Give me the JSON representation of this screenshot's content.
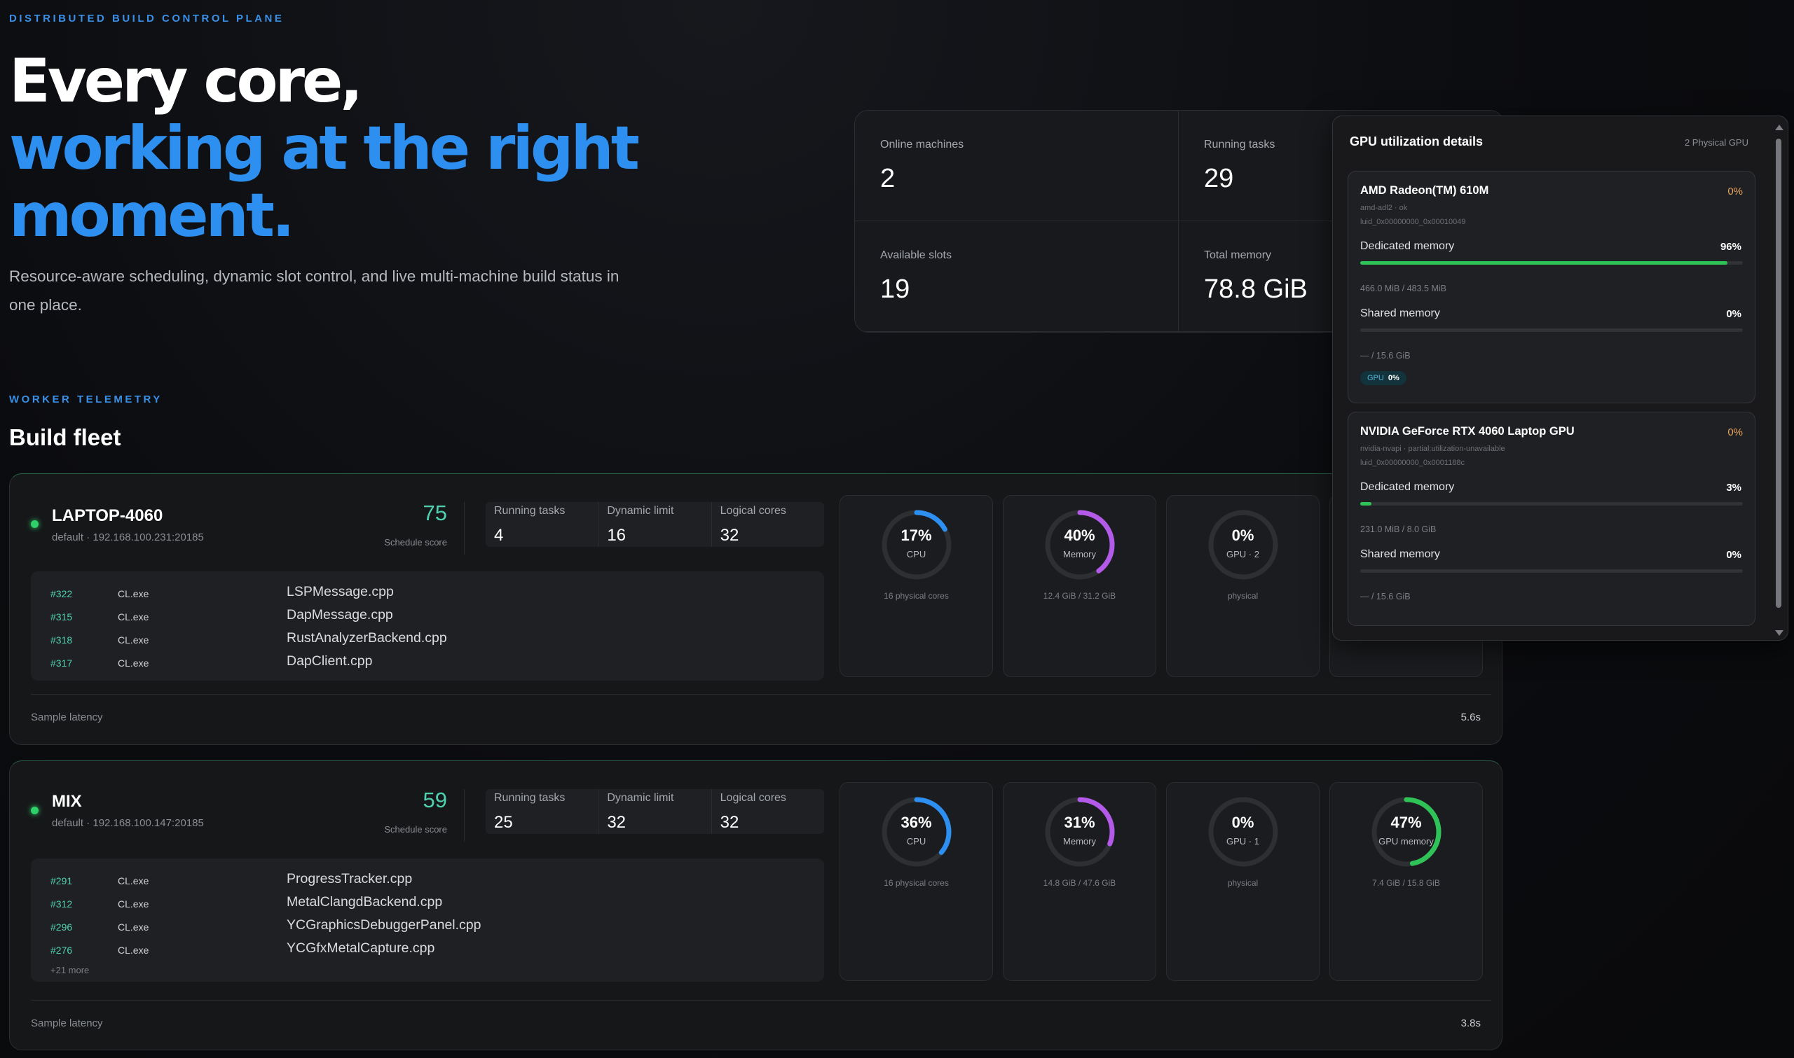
{
  "header": {
    "eyebrow": "DISTRIBUTED BUILD CONTROL PLANE",
    "hero_line1": "Every core,",
    "hero_line2": "working at the right",
    "hero_line3": "moment.",
    "subtitle": "Resource-aware scheduling, dynamic slot control, and live multi-machine build status in one place."
  },
  "summary": [
    {
      "label": "Online machines",
      "value": "2"
    },
    {
      "label": "Running tasks",
      "value": "29"
    },
    {
      "label": "Available slots",
      "value": "19"
    },
    {
      "label": "Total memory",
      "value": "78.8 GiB"
    }
  ],
  "fleet_section": {
    "eyebrow": "WORKER TELEMETRY",
    "title": "Build fleet"
  },
  "machines": [
    {
      "name": "LAPTOP-4060",
      "address": "default · 192.168.100.231:20185",
      "score": "75",
      "score_label": "Schedule score",
      "stats": [
        {
          "label": "Running tasks",
          "value": "4"
        },
        {
          "label": "Dynamic limit",
          "value": "16"
        },
        {
          "label": "Logical cores",
          "value": "32"
        }
      ],
      "tasks": [
        {
          "id": "#322",
          "proc": "CL.exe",
          "file": "LSPMessage.cpp"
        },
        {
          "id": "#315",
          "proc": "CL.exe",
          "file": "DapMessage.cpp"
        },
        {
          "id": "#318",
          "proc": "CL.exe",
          "file": "RustAnalyzerBackend.cpp"
        },
        {
          "id": "#317",
          "proc": "CL.exe",
          "file": "DapClient.cpp"
        }
      ],
      "gauges": [
        {
          "value": "17%",
          "label": "CPU",
          "sub": "16 physical cores",
          "fraction": 0.17,
          "color": "#2d8ff0"
        },
        {
          "value": "40%",
          "label": "Memory",
          "sub": "12.4 GiB / 31.2 GiB",
          "fraction": 0.4,
          "color": "#b35ae8"
        },
        {
          "value": "0%",
          "label": "GPU · 2",
          "sub": "physical",
          "fraction": 0.0,
          "color": "#2fc257"
        }
      ],
      "latency_label": "Sample latency",
      "latency_value": "5.6s"
    },
    {
      "name": "MIX",
      "address": "default · 192.168.100.147:20185",
      "score": "59",
      "score_label": "Schedule score",
      "stats": [
        {
          "label": "Running tasks",
          "value": "25"
        },
        {
          "label": "Dynamic limit",
          "value": "32"
        },
        {
          "label": "Logical cores",
          "value": "32"
        }
      ],
      "tasks": [
        {
          "id": "#291",
          "proc": "CL.exe",
          "file": "ProgressTracker.cpp"
        },
        {
          "id": "#312",
          "proc": "CL.exe",
          "file": "MetalClangdBackend.cpp"
        },
        {
          "id": "#296",
          "proc": "CL.exe",
          "file": "YCGraphicsDebuggerPanel.cpp"
        },
        {
          "id": "#276",
          "proc": "CL.exe",
          "file": "YCGfxMetalCapture.cpp"
        }
      ],
      "more": "+21 more",
      "gauges": [
        {
          "value": "36%",
          "label": "CPU",
          "sub": "16 physical cores",
          "fraction": 0.36,
          "color": "#2d8ff0"
        },
        {
          "value": "31%",
          "label": "Memory",
          "sub": "14.8 GiB / 47.6 GiB",
          "fraction": 0.31,
          "color": "#b35ae8"
        },
        {
          "value": "0%",
          "label": "GPU · 1",
          "sub": "physical",
          "fraction": 0.0,
          "color": "#2fc257"
        },
        {
          "value": "47%",
          "label": "GPU memory",
          "sub": "7.4 GiB / 15.8 GiB",
          "fraction": 0.47,
          "color": "#2fc257"
        }
      ],
      "latency_label": "Sample latency",
      "latency_value": "3.8s"
    }
  ],
  "gpu_panel": {
    "title": "GPU utilization details",
    "count": "2 Physical GPU",
    "gpus": [
      {
        "name": "AMD Radeon(TM) 610M",
        "util": "0%",
        "meta1": "amd-adl2 · ok",
        "meta2": "luid_0x00000000_0x00010049",
        "dedicated_label": "Dedicated memory",
        "dedicated_pct": "96%",
        "dedicated_fraction": 0.96,
        "dedicated_sub": "466.0 MiB / 483.5 MiB",
        "shared_label": "Shared memory",
        "shared_pct": "0%",
        "shared_fraction": 0.0,
        "shared_sub": "— / 15.6 GiB",
        "chip_label": "GPU",
        "chip_value": "0%"
      },
      {
        "name": "NVIDIA GeForce RTX 4060 Laptop GPU",
        "util": "0%",
        "meta1": "nvidia-nvapi · partial:utilization-unavailable",
        "meta2": "luid_0x00000000_0x0001188c",
        "dedicated_label": "Dedicated memory",
        "dedicated_pct": "3%",
        "dedicated_fraction": 0.03,
        "dedicated_sub": "231.0 MiB / 8.0 GiB",
        "shared_label": "Shared memory",
        "shared_pct": "0%",
        "shared_fraction": 0.0,
        "shared_sub": "— / 15.6 GiB"
      }
    ]
  }
}
